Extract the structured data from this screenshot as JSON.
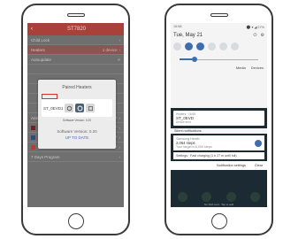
{
  "phone1": {
    "app_title": "ST7820",
    "rows": [
      {
        "label": "Child Lock",
        "value": "",
        "type": "chev"
      },
      {
        "label": "Heaters",
        "value": "1 device",
        "type": "chev",
        "highlight": true
      },
      {
        "label": "Autoupdate",
        "value": "",
        "type": "dot"
      },
      {
        "label": "",
        "value": "",
        "type": "blank"
      },
      {
        "label": "",
        "value": "",
        "type": "blank"
      },
      {
        "label": "",
        "value": "",
        "type": "blank"
      },
      {
        "label": "",
        "value": "",
        "type": "blank"
      },
      {
        "label": "",
        "value": "",
        "type": "blank"
      },
      {
        "label": "Antifreeze program",
        "value": "OFF",
        "type": "chev"
      },
      {
        "label": "Antifreeze Temperature",
        "value": "15.5°",
        "type": "chev",
        "swatch": "#7a1e1e"
      },
      {
        "label": "Eco",
        "value": "20.0°",
        "type": "chev",
        "swatch": "#2a4a8a"
      },
      {
        "label": "Comfort",
        "value": "16.5°",
        "type": "chev",
        "swatch": "#c0392b"
      },
      {
        "label": "7 Days Program",
        "value": "",
        "type": "chev"
      }
    ],
    "dialog": {
      "title": "Paired Heaters",
      "device_id": "ST_0EVD1",
      "software": "Software Version: 0.20",
      "version": "Software Version: 0.20",
      "update": "UP TO DATE"
    }
  },
  "phone2": {
    "status_time": "16:58",
    "status_right": "⚫ ▾ ◢ 27%",
    "date": "Tue, May 21",
    "media_label": "Media",
    "devices_label": "Devices",
    "card_app": "Heaters · 16:58",
    "card_title": "ST_0EVD",
    "card_sub": "Device error",
    "silent_title": "Silent notifications",
    "notif1_app": "Samsung Health",
    "notif1_title": "2,064 steps",
    "notif1_sub": "Your target is 6,000 steps",
    "notif2": "Settings · Fast charging (1 h 27 m until full)",
    "footer_settings": "Notification settings",
    "footer_clear": "Clear",
    "dock_text": "No SIM card · Tap to add"
  }
}
